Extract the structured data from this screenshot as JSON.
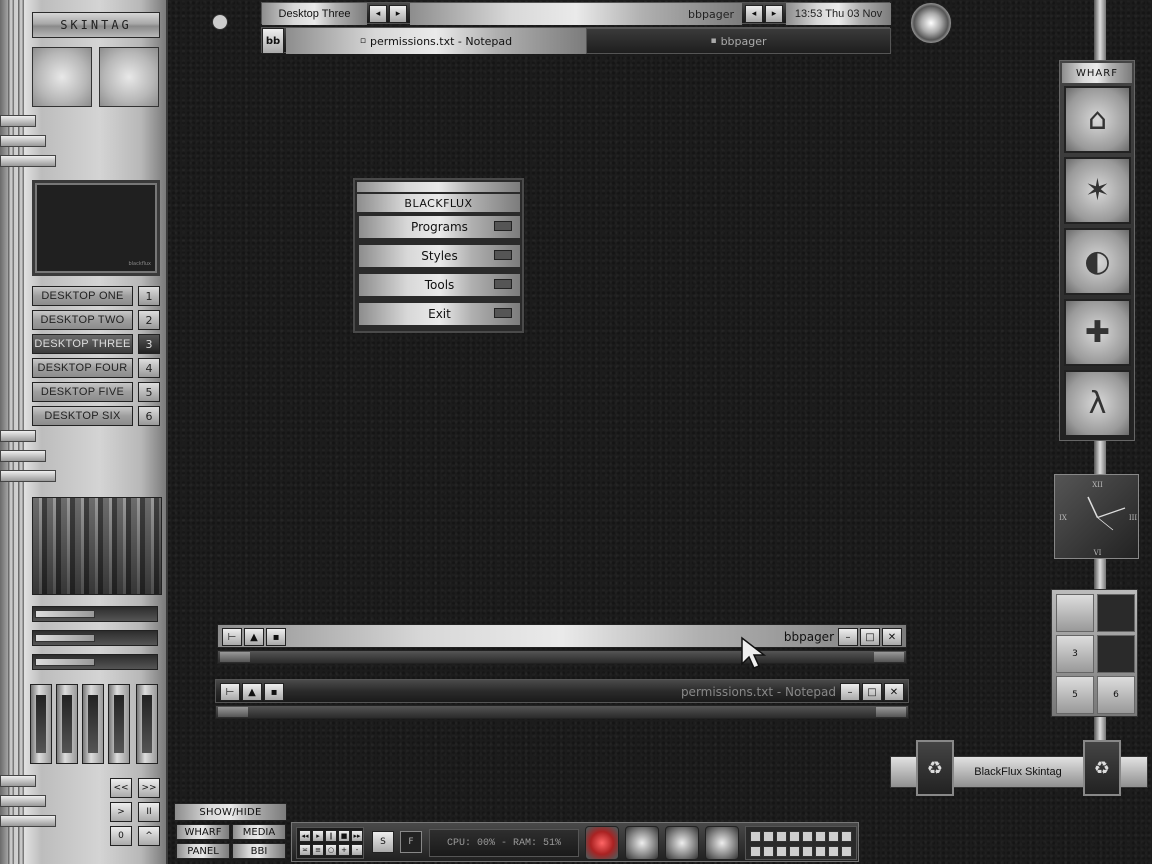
{
  "slit": {
    "title": "SKINTAG",
    "preview_caption": "blackflux",
    "desktops": [
      {
        "label": "DESKTOP ONE",
        "num": "1"
      },
      {
        "label": "DESKTOP TWO",
        "num": "2"
      },
      {
        "label": "DESKTOP THREE",
        "num": "3"
      },
      {
        "label": "DESKTOP FOUR",
        "num": "4"
      },
      {
        "label": "DESKTOP FIVE",
        "num": "5"
      },
      {
        "label": "DESKTOP SIX",
        "num": "6"
      }
    ],
    "active_desktop_index": 2,
    "sliders": [
      0.5,
      0.5,
      0.5
    ],
    "media_labels": {
      "prev": "<<",
      "next": ">>",
      "play": ">",
      "pause": "II",
      "stop": "0",
      "up": "^"
    }
  },
  "toolbar": {
    "workspace": "Desktop Three",
    "window_label": "bbpager",
    "clock": "13:53 Thu 03 Nov",
    "bb_button": "bb",
    "tasks": [
      {
        "label": "permissions.txt - Notepad",
        "icon": "file-icon"
      },
      {
        "label": "bbpager",
        "icon": "folder-icon"
      }
    ]
  },
  "menu": {
    "title": "BLACKFLUX",
    "items": [
      "Programs",
      "Styles",
      "Tools",
      "Exit"
    ]
  },
  "wharf": {
    "title": "WHARF",
    "icons": [
      "network-icon",
      "dragon-icon",
      "nvidia-icon",
      "puzzle-icon",
      "half-life-icon"
    ]
  },
  "analog_clock": {
    "numerals": {
      "top": "XII",
      "right": "III",
      "bottom": "VI",
      "left": "IX"
    }
  },
  "pager": {
    "cells": [
      "",
      "",
      "3",
      "",
      "5",
      "6"
    ]
  },
  "windows": [
    {
      "title": "bbpager"
    },
    {
      "title": "permissions.txt - Notepad"
    }
  ],
  "panel": {
    "show_hide": "SHOW/HIDE",
    "wharf": "WHARF",
    "media": "MEDIA",
    "panel": "PANEL",
    "bbi": "BBI",
    "s_btn": "S",
    "f_btn": "F",
    "sysmon": "CPU: 00% - RAM: 51%"
  },
  "skin_label": "BlackFlux Skintag",
  "colors": {
    "accent": "#c0392b",
    "chrome": "#b0b0b0",
    "desktop": "#1c1c1c"
  }
}
